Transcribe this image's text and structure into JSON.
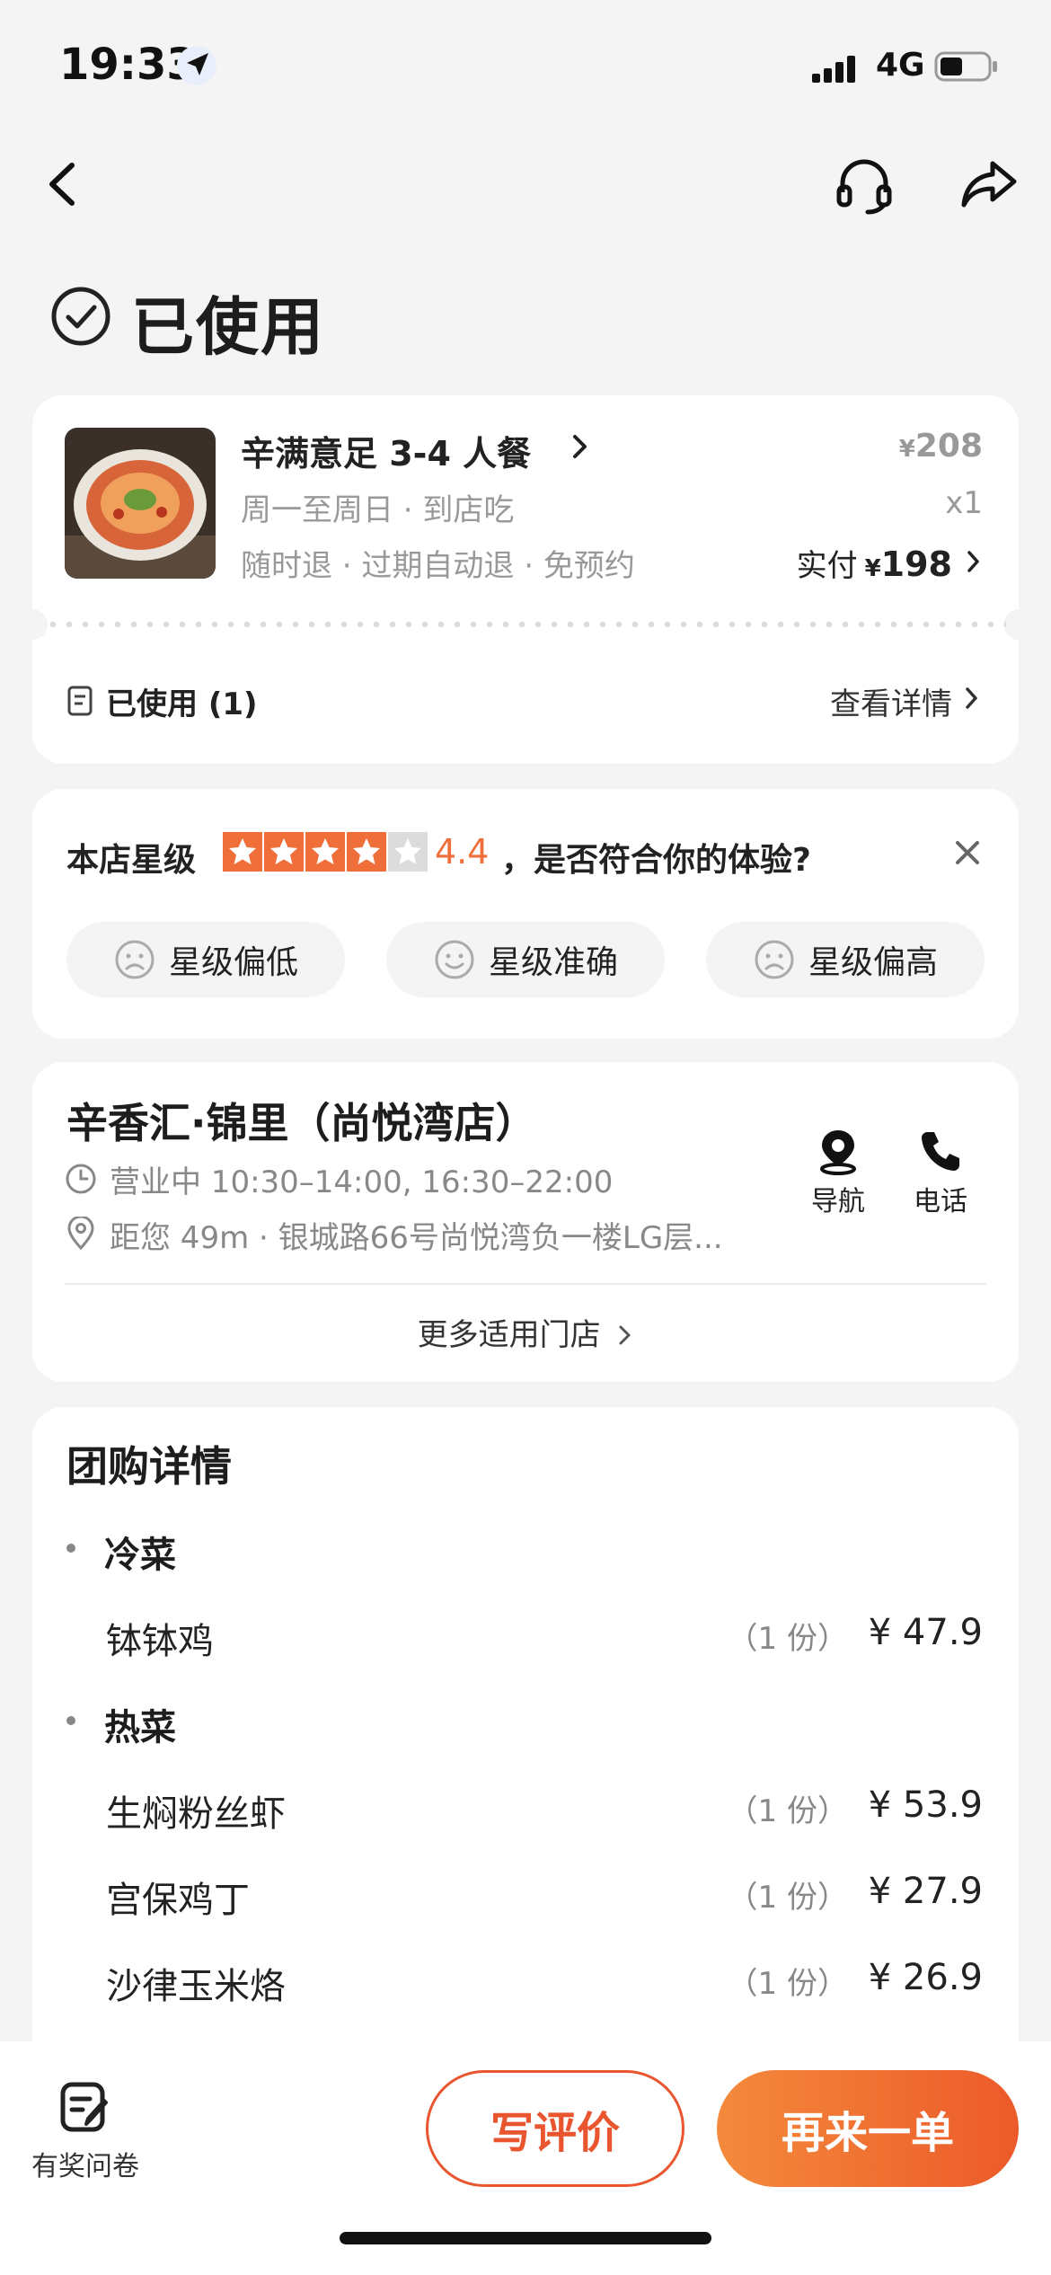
{
  "status_bar": {
    "time": "19:33",
    "network": "4G"
  },
  "nav": {
    "back_icon": "chevron-left-icon",
    "service_icon": "headset-icon",
    "share_icon": "share-icon"
  },
  "order_status": {
    "title": "已使用"
  },
  "order": {
    "product_name": "辛满意足 3-4 人餐",
    "line2": "周一至周日 · 到店吃",
    "line3": "随时退 · 过期自动退 · 免预约",
    "original_price_symbol": "¥",
    "original_price": "208",
    "quantity": "x1",
    "paid_label": "实付",
    "paid_symbol": "¥",
    "paid_amount": "198",
    "used_label": "已使用 (1)",
    "view_details": "查看详情"
  },
  "rating": {
    "label": "本店星级",
    "stars_filled": 4,
    "stars_total": 5,
    "score": "4.4",
    "question": "，是否符合你的体验?",
    "options": [
      "星级偏低",
      "星级准确",
      "星级偏高"
    ]
  },
  "store": {
    "name": "辛香汇·锦里（尚悦湾店）",
    "hours": "营业中 10:30–14:00, 16:30–22:00",
    "address": "距您 49m ·  银城路66号尚悦湾负一楼LG层...",
    "navigate_label": "导航",
    "call_label": "电话",
    "more_stores": "更多适用门店"
  },
  "details": {
    "title": "团购详情",
    "sections": [
      {
        "name": "冷菜",
        "items": [
          {
            "name": "钵钵鸡",
            "qty": "（1 份）",
            "price": "¥ 47.9"
          }
        ]
      },
      {
        "name": "热菜",
        "items": [
          {
            "name": "生焖粉丝虾",
            "qty": "（1 份）",
            "price": "¥ 53.9"
          },
          {
            "name": "宫保鸡丁",
            "qty": "（1 份）",
            "price": "¥ 27.9"
          },
          {
            "name": "沙律玉米烙",
            "qty": "（1 份）",
            "price": "¥ 26.9"
          }
        ]
      }
    ]
  },
  "bottom_bar": {
    "survey_label": "有奖问卷",
    "review_button": "写评价",
    "reorder_button": "再来一单"
  },
  "colors": {
    "accent": "#e9552e",
    "star": "#f06e3a",
    "background": "#f4f4f4"
  }
}
